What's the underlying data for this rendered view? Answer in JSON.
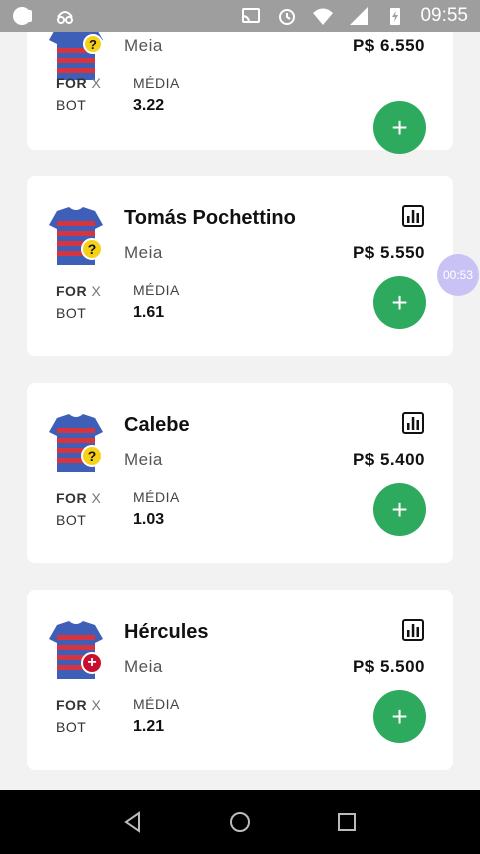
{
  "status_bar": {
    "time": "09:55"
  },
  "floating_timer": "00:53",
  "players": [
    {
      "name": "",
      "position": "Meia",
      "price": "P$ 6.550",
      "vs_home": "FOR",
      "vs_sep": "X",
      "vs_away": "BOT",
      "media_label": "MÉDIA",
      "media": "3.22",
      "status": "doubt"
    },
    {
      "name": "Tomás Pochettino",
      "position": "Meia",
      "price": "P$ 5.550",
      "vs_home": "FOR",
      "vs_sep": "X",
      "vs_away": "BOT",
      "media_label": "MÉDIA",
      "media": "1.61",
      "status": "doubt"
    },
    {
      "name": "Calebe",
      "position": "Meia",
      "price": "P$ 5.400",
      "vs_home": "FOR",
      "vs_sep": "X",
      "vs_away": "BOT",
      "media_label": "MÉDIA",
      "media": "1.03",
      "status": "doubt"
    },
    {
      "name": "Hércules",
      "position": "Meia",
      "price": "P$ 5.500",
      "vs_home": "FOR",
      "vs_sep": "X",
      "vs_away": "BOT",
      "media_label": "MÉDIA",
      "media": "1.21",
      "status": "injured"
    }
  ],
  "colors": {
    "add_button": "#2eaa5f",
    "doubt_badge": "#f7d117",
    "injured_badge": "#c8102e",
    "shirt_red": "#d6343f",
    "shirt_blue": "#3e5fb7"
  },
  "icons": {
    "add": "+",
    "stats": "bar-chart-icon",
    "nav_back": "back-triangle-icon",
    "nav_home": "home-circle-icon",
    "nav_recents": "recents-square-icon"
  }
}
